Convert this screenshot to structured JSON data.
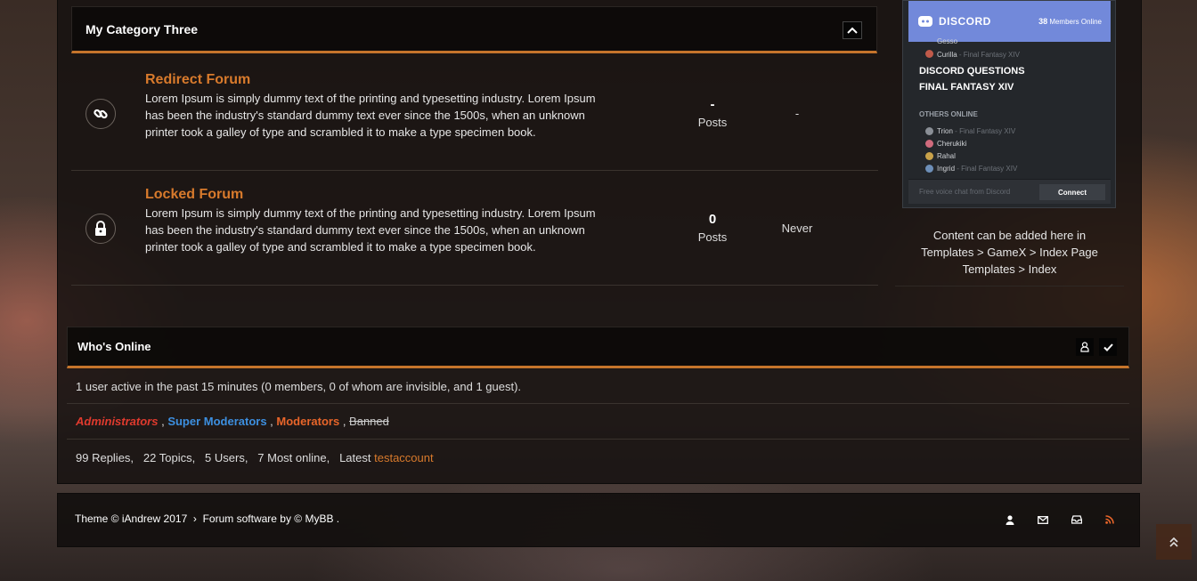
{
  "category": {
    "title": "My Category Three",
    "forums": [
      {
        "name": "Redirect Forum",
        "description": "Lorem Ipsum is simply dummy text of the printing and typesetting industry. Lorem Ipsum has been the industry's standard dummy text ever since the 1500s, when an unknown printer took a galley of type and scrambled it to make a type specimen book.",
        "posts_value": "-",
        "posts_label": "Posts",
        "last_post": "-",
        "icon": "link-icon"
      },
      {
        "name": "Locked Forum",
        "description": "Lorem Ipsum is simply dummy text of the printing and typesetting industry. Lorem Ipsum has been the industry's standard dummy text ever since the 1500s, when an unknown printer took a galley of type and scrambled it to make a type specimen book.",
        "posts_value": "0",
        "posts_label": "Posts",
        "last_post": "Never",
        "icon": "lock-icon"
      }
    ]
  },
  "discord": {
    "logo": "DISCORD",
    "members_count": "38",
    "members_label": "Members Online",
    "users_top": [
      {
        "name": "Gesso",
        "game": ""
      },
      {
        "name": "Curilla",
        "game": "Final Fantasy XIV"
      }
    ],
    "channels": [
      "DISCORD QUESTIONS",
      "FINAL FANTASY XIV"
    ],
    "others_label": "OTHERS ONLINE",
    "others": [
      {
        "name": "Trion",
        "game": "Final Fantasy XIV"
      },
      {
        "name": "Cherukiki",
        "game": ""
      },
      {
        "name": "Rahal",
        "game": ""
      },
      {
        "name": "Ingrid",
        "game": "Final Fantasy XIV"
      }
    ],
    "footer_text": "Free voice chat from Discord",
    "connect_label": "Connect"
  },
  "sidebar": {
    "line1": "Content can be added here in",
    "line2": "Templates > GameX > Index Page",
    "line3": "Templates > Index"
  },
  "whos_online": {
    "title": "Who's Online",
    "active_text": "1 user active in the past 15 minutes (0 members, 0 of whom are invisible, and 1 guest).",
    "groups": {
      "administrators": "Administrators",
      "super_moderators": "Super Moderators",
      "moderators": "Moderators",
      "banned": "Banned",
      "separator": " , "
    },
    "stats": {
      "replies": "99 Replies,",
      "topics": "22 Topics,",
      "users": "5 Users,",
      "most_online": "7 Most online,",
      "latest_label": "Latest",
      "latest_user": "testaccount"
    }
  },
  "footer": {
    "theme_text": "Theme © iAndrew 2017",
    "arrow": "›",
    "software_text": "Forum software by © MyBB ."
  },
  "colors": {
    "accent": "#c5742b",
    "forum_link": "#d87a2c",
    "administrators": "#e03a2e",
    "super_moderators": "#3d8fe0",
    "moderators": "#e8652a",
    "discord_blurple": "#7289da",
    "rss": "#e8652a"
  }
}
